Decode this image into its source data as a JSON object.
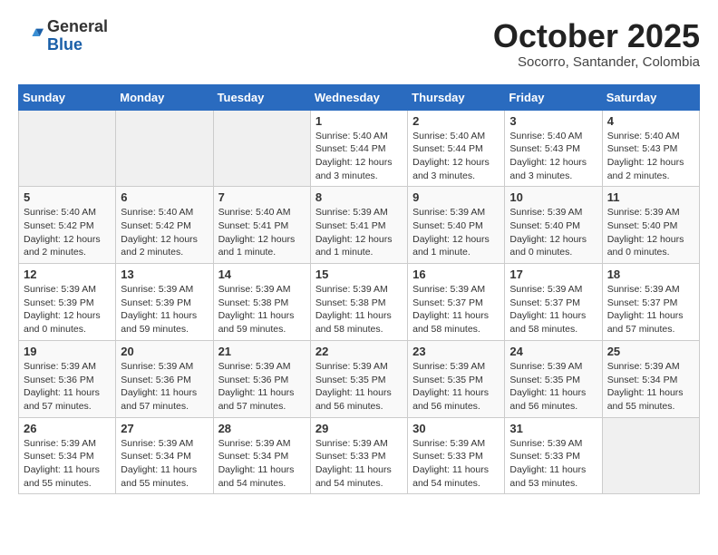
{
  "header": {
    "logo_general": "General",
    "logo_blue": "Blue",
    "month_title": "October 2025",
    "location": "Socorro, Santander, Colombia"
  },
  "calendar": {
    "days_of_week": [
      "Sunday",
      "Monday",
      "Tuesday",
      "Wednesday",
      "Thursday",
      "Friday",
      "Saturday"
    ],
    "weeks": [
      [
        {
          "day": "",
          "empty": true
        },
        {
          "day": "",
          "empty": true
        },
        {
          "day": "",
          "empty": true
        },
        {
          "day": "1",
          "sunrise": "Sunrise: 5:40 AM",
          "sunset": "Sunset: 5:44 PM",
          "daylight": "Daylight: 12 hours and 3 minutes."
        },
        {
          "day": "2",
          "sunrise": "Sunrise: 5:40 AM",
          "sunset": "Sunset: 5:44 PM",
          "daylight": "Daylight: 12 hours and 3 minutes."
        },
        {
          "day": "3",
          "sunrise": "Sunrise: 5:40 AM",
          "sunset": "Sunset: 5:43 PM",
          "daylight": "Daylight: 12 hours and 3 minutes."
        },
        {
          "day": "4",
          "sunrise": "Sunrise: 5:40 AM",
          "sunset": "Sunset: 5:43 PM",
          "daylight": "Daylight: 12 hours and 2 minutes."
        }
      ],
      [
        {
          "day": "5",
          "sunrise": "Sunrise: 5:40 AM",
          "sunset": "Sunset: 5:42 PM",
          "daylight": "Daylight: 12 hours and 2 minutes."
        },
        {
          "day": "6",
          "sunrise": "Sunrise: 5:40 AM",
          "sunset": "Sunset: 5:42 PM",
          "daylight": "Daylight: 12 hours and 2 minutes."
        },
        {
          "day": "7",
          "sunrise": "Sunrise: 5:40 AM",
          "sunset": "Sunset: 5:41 PM",
          "daylight": "Daylight: 12 hours and 1 minute."
        },
        {
          "day": "8",
          "sunrise": "Sunrise: 5:39 AM",
          "sunset": "Sunset: 5:41 PM",
          "daylight": "Daylight: 12 hours and 1 minute."
        },
        {
          "day": "9",
          "sunrise": "Sunrise: 5:39 AM",
          "sunset": "Sunset: 5:40 PM",
          "daylight": "Daylight: 12 hours and 1 minute."
        },
        {
          "day": "10",
          "sunrise": "Sunrise: 5:39 AM",
          "sunset": "Sunset: 5:40 PM",
          "daylight": "Daylight: 12 hours and 0 minutes."
        },
        {
          "day": "11",
          "sunrise": "Sunrise: 5:39 AM",
          "sunset": "Sunset: 5:40 PM",
          "daylight": "Daylight: 12 hours and 0 minutes."
        }
      ],
      [
        {
          "day": "12",
          "sunrise": "Sunrise: 5:39 AM",
          "sunset": "Sunset: 5:39 PM",
          "daylight": "Daylight: 12 hours and 0 minutes."
        },
        {
          "day": "13",
          "sunrise": "Sunrise: 5:39 AM",
          "sunset": "Sunset: 5:39 PM",
          "daylight": "Daylight: 11 hours and 59 minutes."
        },
        {
          "day": "14",
          "sunrise": "Sunrise: 5:39 AM",
          "sunset": "Sunset: 5:38 PM",
          "daylight": "Daylight: 11 hours and 59 minutes."
        },
        {
          "day": "15",
          "sunrise": "Sunrise: 5:39 AM",
          "sunset": "Sunset: 5:38 PM",
          "daylight": "Daylight: 11 hours and 58 minutes."
        },
        {
          "day": "16",
          "sunrise": "Sunrise: 5:39 AM",
          "sunset": "Sunset: 5:37 PM",
          "daylight": "Daylight: 11 hours and 58 minutes."
        },
        {
          "day": "17",
          "sunrise": "Sunrise: 5:39 AM",
          "sunset": "Sunset: 5:37 PM",
          "daylight": "Daylight: 11 hours and 58 minutes."
        },
        {
          "day": "18",
          "sunrise": "Sunrise: 5:39 AM",
          "sunset": "Sunset: 5:37 PM",
          "daylight": "Daylight: 11 hours and 57 minutes."
        }
      ],
      [
        {
          "day": "19",
          "sunrise": "Sunrise: 5:39 AM",
          "sunset": "Sunset: 5:36 PM",
          "daylight": "Daylight: 11 hours and 57 minutes."
        },
        {
          "day": "20",
          "sunrise": "Sunrise: 5:39 AM",
          "sunset": "Sunset: 5:36 PM",
          "daylight": "Daylight: 11 hours and 57 minutes."
        },
        {
          "day": "21",
          "sunrise": "Sunrise: 5:39 AM",
          "sunset": "Sunset: 5:36 PM",
          "daylight": "Daylight: 11 hours and 57 minutes."
        },
        {
          "day": "22",
          "sunrise": "Sunrise: 5:39 AM",
          "sunset": "Sunset: 5:35 PM",
          "daylight": "Daylight: 11 hours and 56 minutes."
        },
        {
          "day": "23",
          "sunrise": "Sunrise: 5:39 AM",
          "sunset": "Sunset: 5:35 PM",
          "daylight": "Daylight: 11 hours and 56 minutes."
        },
        {
          "day": "24",
          "sunrise": "Sunrise: 5:39 AM",
          "sunset": "Sunset: 5:35 PM",
          "daylight": "Daylight: 11 hours and 56 minutes."
        },
        {
          "day": "25",
          "sunrise": "Sunrise: 5:39 AM",
          "sunset": "Sunset: 5:34 PM",
          "daylight": "Daylight: 11 hours and 55 minutes."
        }
      ],
      [
        {
          "day": "26",
          "sunrise": "Sunrise: 5:39 AM",
          "sunset": "Sunset: 5:34 PM",
          "daylight": "Daylight: 11 hours and 55 minutes."
        },
        {
          "day": "27",
          "sunrise": "Sunrise: 5:39 AM",
          "sunset": "Sunset: 5:34 PM",
          "daylight": "Daylight: 11 hours and 55 minutes."
        },
        {
          "day": "28",
          "sunrise": "Sunrise: 5:39 AM",
          "sunset": "Sunset: 5:34 PM",
          "daylight": "Daylight: 11 hours and 54 minutes."
        },
        {
          "day": "29",
          "sunrise": "Sunrise: 5:39 AM",
          "sunset": "Sunset: 5:33 PM",
          "daylight": "Daylight: 11 hours and 54 minutes."
        },
        {
          "day": "30",
          "sunrise": "Sunrise: 5:39 AM",
          "sunset": "Sunset: 5:33 PM",
          "daylight": "Daylight: 11 hours and 54 minutes."
        },
        {
          "day": "31",
          "sunrise": "Sunrise: 5:39 AM",
          "sunset": "Sunset: 5:33 PM",
          "daylight": "Daylight: 11 hours and 53 minutes."
        },
        {
          "day": "",
          "empty": true
        }
      ]
    ]
  }
}
